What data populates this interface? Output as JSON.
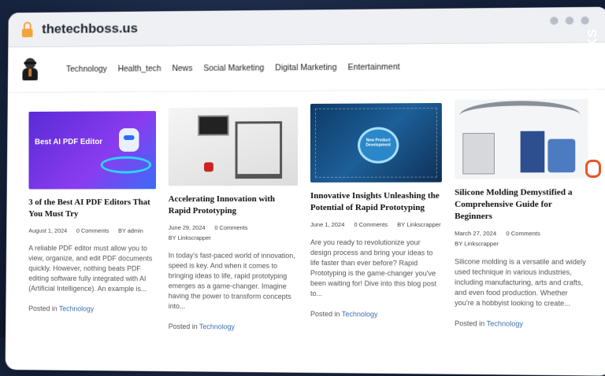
{
  "browser": {
    "url": "thetechboss.us"
  },
  "nav": {
    "items": [
      "Technology",
      "Health_tech",
      "News",
      "Social Marketing",
      "Digital Marketing",
      "Entertainment"
    ]
  },
  "posts": [
    {
      "thumb_text": "Best AI PDF Editor",
      "title": "3 of the Best AI PDF Editors That You Must Try",
      "date": "August 1, 2024",
      "comments": "0 Comments",
      "author": "BY admin",
      "excerpt": "A reliable PDF editor must allow you to view, organize, and edit PDF documents quickly. However, nothing beats PDF editing software fully integrated with AI (Artificial Intelligence). An example is...",
      "posted_prefix": "Posted in",
      "category": "Technology"
    },
    {
      "title": "Accelerating Innovation with Rapid Prototyping",
      "date": "June 29, 2024",
      "comments": "0 Comments",
      "author": "BY Linkscrapper",
      "excerpt": "In today's fast-paced world of innovation, speed is key. And when it comes to bringing ideas to life, rapid prototyping emerges as a game-changer. Imagine having the power to transform concepts into...",
      "posted_prefix": "Posted in",
      "category": "Technology"
    },
    {
      "thumb_text": "New Product Development",
      "title": "Innovative Insights Unleashing the Potential of Rapid Prototyping",
      "date": "June 1, 2024",
      "comments": "0 Comments",
      "author": "BY Linkscrapper",
      "excerpt": "Are you ready to revolutionize your design process and bring your ideas to life faster than ever before? Rapid Prototyping is the game-changer you've been waiting for! Dive into this blog post to...",
      "posted_prefix": "Posted in",
      "category": "Technology"
    },
    {
      "title": "Silicone Molding Demystified a Comprehensive Guide for Beginners",
      "date": "March 27, 2024",
      "comments": "0 Comments",
      "author": "BY Linkscrapper",
      "excerpt": "Silicone molding is a versatile and widely used technique in various industries, including manufacturing, arts and crafts, and even food production. Whether you're a hobbyist looking to create...",
      "posted_prefix": "Posted in",
      "category": "Technology"
    }
  ],
  "badge": {
    "text": "GUESTPOSTLINKS"
  },
  "colors": {
    "accent": "#3a6fb0",
    "lock": "#f2a33a",
    "badge_icon": "#e8562a"
  }
}
